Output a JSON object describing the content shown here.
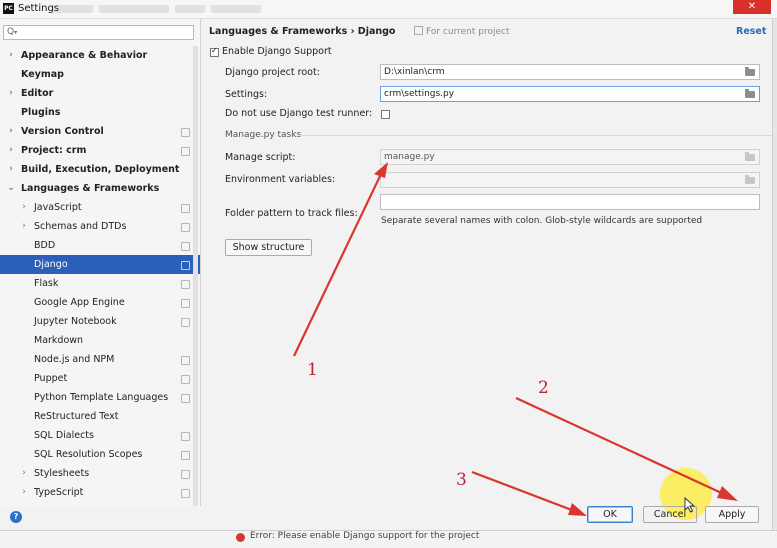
{
  "window": {
    "title": "Settings",
    "app_icon": "PC",
    "close_glyph": "✕"
  },
  "sidebar": {
    "search": {
      "value": "",
      "placeholder": ""
    },
    "items": [
      {
        "label": "Appearance & Behavior",
        "level": 0,
        "expandable": true,
        "expanded": false,
        "bold": true,
        "project_icon": false,
        "selected": false
      },
      {
        "label": "Keymap",
        "level": 0,
        "expandable": false,
        "bold": true,
        "project_icon": false,
        "selected": false
      },
      {
        "label": "Editor",
        "level": 0,
        "expandable": true,
        "expanded": false,
        "bold": true,
        "project_icon": false,
        "selected": false
      },
      {
        "label": "Plugins",
        "level": 0,
        "expandable": false,
        "bold": true,
        "project_icon": false,
        "selected": false
      },
      {
        "label": "Version Control",
        "level": 0,
        "expandable": true,
        "expanded": false,
        "bold": true,
        "project_icon": true,
        "selected": false
      },
      {
        "label": "Project: crm",
        "level": 0,
        "expandable": true,
        "expanded": false,
        "bold": true,
        "project_icon": true,
        "selected": false
      },
      {
        "label": "Build, Execution, Deployment",
        "level": 0,
        "expandable": true,
        "expanded": false,
        "bold": true,
        "project_icon": false,
        "selected": false
      },
      {
        "label": "Languages & Frameworks",
        "level": 0,
        "expandable": true,
        "expanded": true,
        "bold": true,
        "project_icon": false,
        "selected": false
      },
      {
        "label": "JavaScript",
        "level": 1,
        "expandable": true,
        "expanded": false,
        "bold": false,
        "project_icon": true,
        "selected": false
      },
      {
        "label": "Schemas and DTDs",
        "level": 1,
        "expandable": true,
        "expanded": false,
        "bold": false,
        "project_icon": true,
        "selected": false
      },
      {
        "label": "BDD",
        "level": 1,
        "expandable": false,
        "bold": false,
        "project_icon": true,
        "selected": false
      },
      {
        "label": "Django",
        "level": 1,
        "expandable": false,
        "bold": false,
        "project_icon": true,
        "selected": true
      },
      {
        "label": "Flask",
        "level": 1,
        "expandable": false,
        "bold": false,
        "project_icon": true,
        "selected": false
      },
      {
        "label": "Google App Engine",
        "level": 1,
        "expandable": false,
        "bold": false,
        "project_icon": true,
        "selected": false
      },
      {
        "label": "Jupyter Notebook",
        "level": 1,
        "expandable": false,
        "bold": false,
        "project_icon": true,
        "selected": false
      },
      {
        "label": "Markdown",
        "level": 1,
        "expandable": false,
        "bold": false,
        "project_icon": false,
        "selected": false
      },
      {
        "label": "Node.js and NPM",
        "level": 1,
        "expandable": false,
        "bold": false,
        "project_icon": true,
        "selected": false
      },
      {
        "label": "Puppet",
        "level": 1,
        "expandable": false,
        "bold": false,
        "project_icon": true,
        "selected": false
      },
      {
        "label": "Python Template Languages",
        "level": 1,
        "expandable": false,
        "bold": false,
        "project_icon": true,
        "selected": false
      },
      {
        "label": "ReStructured Text",
        "level": 1,
        "expandable": false,
        "bold": false,
        "project_icon": false,
        "selected": false
      },
      {
        "label": "SQL Dialects",
        "level": 1,
        "expandable": false,
        "bold": false,
        "project_icon": true,
        "selected": false
      },
      {
        "label": "SQL Resolution Scopes",
        "level": 1,
        "expandable": false,
        "bold": false,
        "project_icon": true,
        "selected": false
      },
      {
        "label": "Stylesheets",
        "level": 1,
        "expandable": true,
        "expanded": false,
        "bold": false,
        "project_icon": true,
        "selected": false
      },
      {
        "label": "TypeScript",
        "level": 1,
        "expandable": true,
        "expanded": false,
        "bold": false,
        "project_icon": true,
        "selected": false
      }
    ]
  },
  "header": {
    "breadcrumb": "Languages & Frameworks  ›  Django",
    "project_note": "For current project",
    "reset": "Reset"
  },
  "form": {
    "enable_django": {
      "label": "Enable Django Support",
      "checked": true
    },
    "project_root": {
      "label": "Django project root:",
      "value": "D:\\xinlan\\crm"
    },
    "settings": {
      "label": "Settings:",
      "value": "crm\\settings.py"
    },
    "no_test_runner": {
      "label": "Do not use Django test runner:",
      "checked": false
    },
    "manage_section": {
      "label": "Manage.py tasks"
    },
    "manage_script": {
      "label": "Manage script:",
      "value": "manage.py"
    },
    "env_vars": {
      "label": "Environment variables:",
      "value": ""
    },
    "folder_pattern": {
      "label": "Folder pattern to track files:",
      "value": "",
      "hint": "Separate several names with colon. Glob-style wildcards are supported"
    },
    "show_structure": "Show structure"
  },
  "footer": {
    "help": "?",
    "ok": "OK",
    "cancel": "Cancel",
    "apply": "Apply"
  },
  "status_bar": {
    "text": "Error: Please enable Django support for the project"
  },
  "annotations": {
    "labels": [
      "1",
      "2",
      "3"
    ],
    "color": "#b7232f"
  },
  "colors": {
    "selection": "#2c5fb8",
    "link": "#2a6ab8",
    "close_button": "#d9302b",
    "highlight_halo": "#ffec3c"
  }
}
